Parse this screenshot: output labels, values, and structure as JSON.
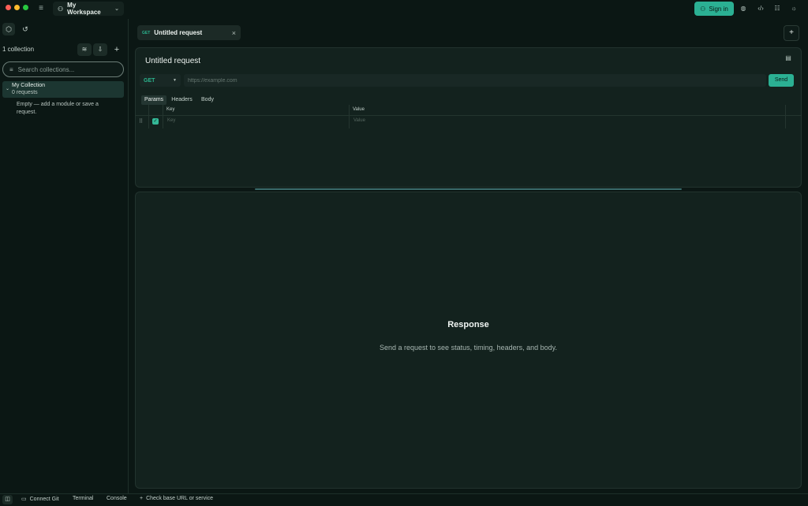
{
  "titlebar": {
    "workspace_label": "My Workspace",
    "signin_label": "Sign in"
  },
  "sidebar": {
    "collection_count": "1 collection",
    "search_placeholder": "Search collections...",
    "collections": [
      {
        "name": "My Collection",
        "count": "0 requests"
      }
    ],
    "empty_note": "Empty — add a module or save a request."
  },
  "tabs": [
    {
      "method": "GET",
      "title": "Untitled request"
    }
  ],
  "request": {
    "title": "Untitled request",
    "method": "GET",
    "url_placeholder": "https://example.com",
    "send_label": "Send",
    "subtabs": [
      "Params",
      "Headers",
      "Body"
    ],
    "active_subtab": "Params",
    "table": {
      "headers": [
        "Key",
        "Value"
      ],
      "rows": [
        {
          "enabled": true,
          "key_placeholder": "Key",
          "value_placeholder": "Value"
        }
      ]
    }
  },
  "response": {
    "title": "Response",
    "subtitle": "Send a request to see status, timing, headers, and body."
  },
  "statusbar": {
    "connect_git": "Connect Git",
    "terminal": "Terminal",
    "console": "Console",
    "hint": "Check base URL or service"
  },
  "colors": {
    "accent": "#2bb093",
    "method_get": "#2bb58f",
    "background": "#0b1714",
    "panel": "#13221e"
  }
}
